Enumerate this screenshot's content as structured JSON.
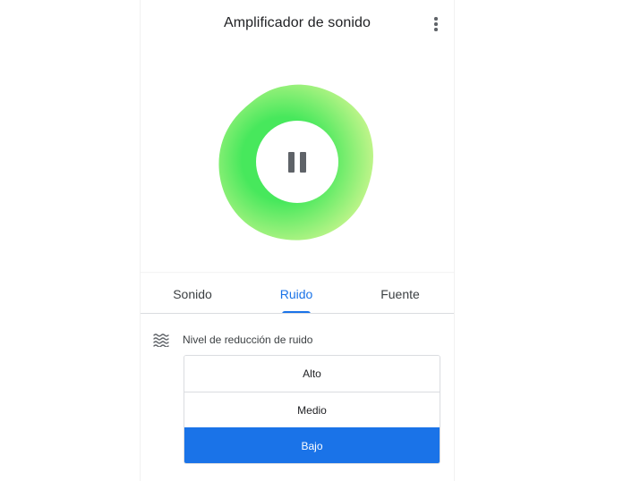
{
  "app": {
    "title": "Amplificador de sonido",
    "accent_color": "#1a73e8",
    "blob_colors": [
      "#47e85c",
      "#c5f58c"
    ]
  },
  "appbar": {
    "more_icon": "more-vert-icon"
  },
  "player": {
    "state_icon": "pause-icon"
  },
  "tabs": [
    {
      "label": "Sonido",
      "active": false
    },
    {
      "label": "Ruido",
      "active": true
    },
    {
      "label": "Fuente",
      "active": false
    }
  ],
  "noise": {
    "icon": "waves-icon",
    "label": "Nivel de reducción de ruido",
    "options": [
      {
        "label": "Alto",
        "selected": false
      },
      {
        "label": "Medio",
        "selected": false
      },
      {
        "label": "Bajo",
        "selected": true
      }
    ]
  }
}
